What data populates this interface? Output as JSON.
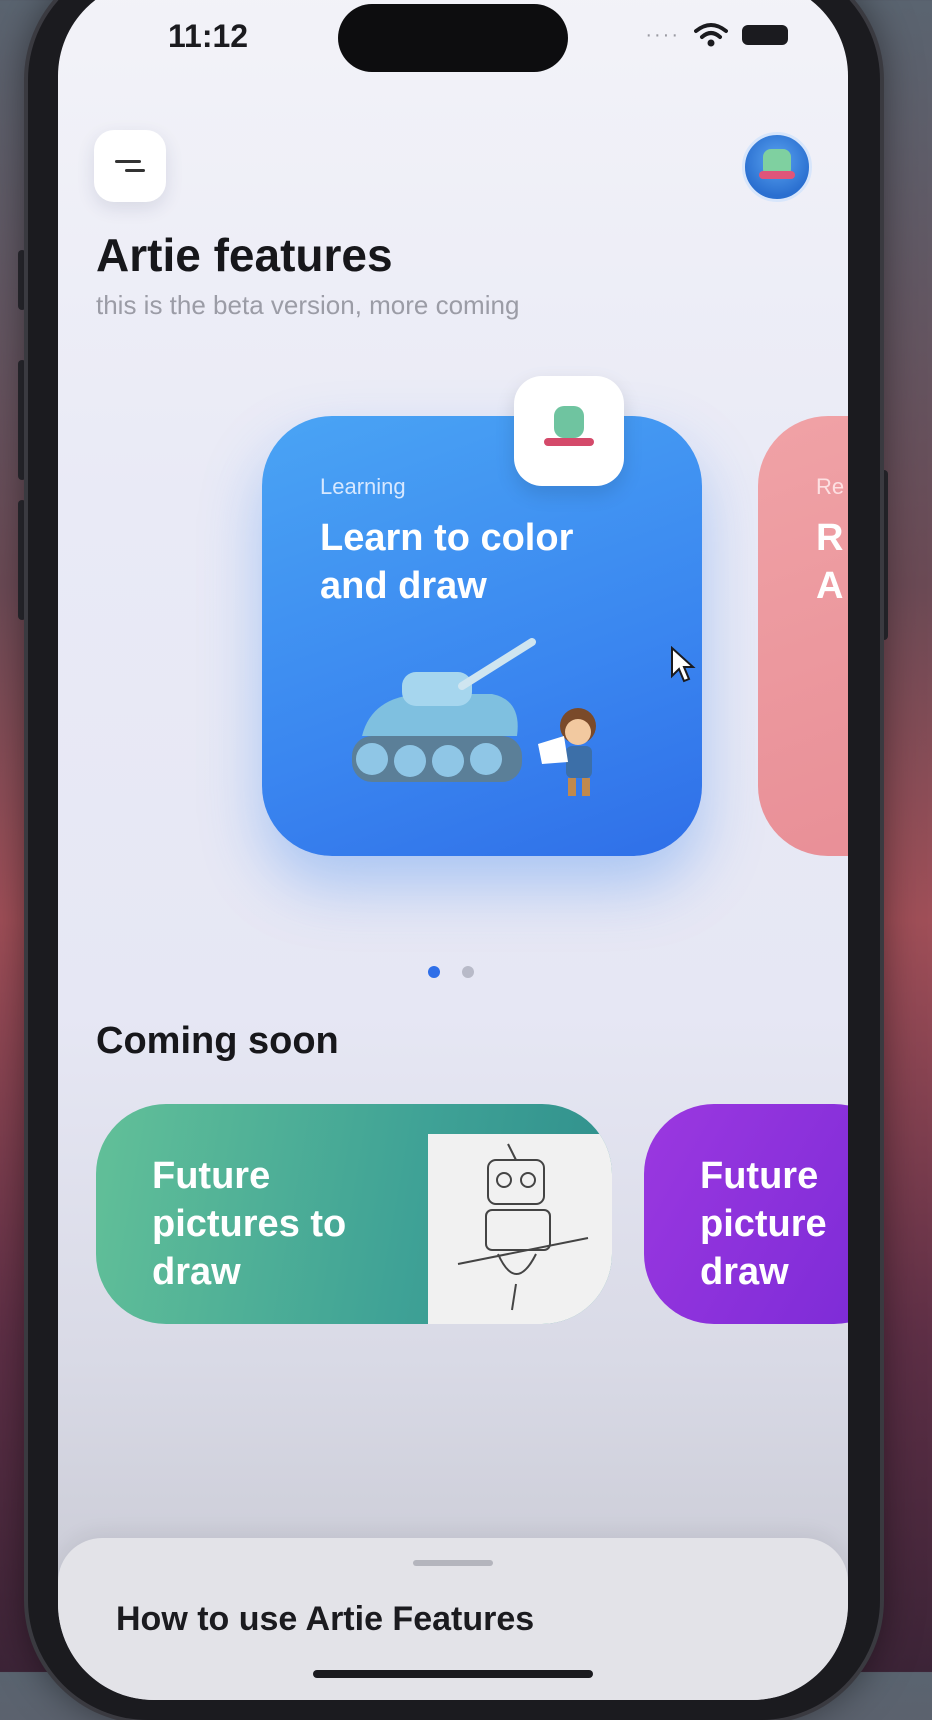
{
  "status_bar": {
    "time": "11:12"
  },
  "header": {
    "title": "Artie features",
    "subtitle": "this is the beta version, more coming"
  },
  "features": [
    {
      "category": "Learning",
      "title": "Learn to color and draw",
      "color": "#3a86f0"
    },
    {
      "category": "Re",
      "title": "R\nA",
      "color": "#e88e96"
    }
  ],
  "carousel": {
    "pages": 2,
    "active": 1
  },
  "coming_soon": {
    "title": "Coming soon",
    "items": [
      {
        "title": "Future pictures to draw",
        "color": "#3fa296"
      },
      {
        "title": "Future picture draw",
        "color": "#7a2ad6"
      }
    ]
  },
  "bottom_sheet": {
    "title": "How to use Artie Features"
  },
  "icons": {
    "menu": "menu-icon",
    "avatar": "avatar-robot",
    "wifi": "wifi-icon",
    "battery": "battery-icon"
  }
}
